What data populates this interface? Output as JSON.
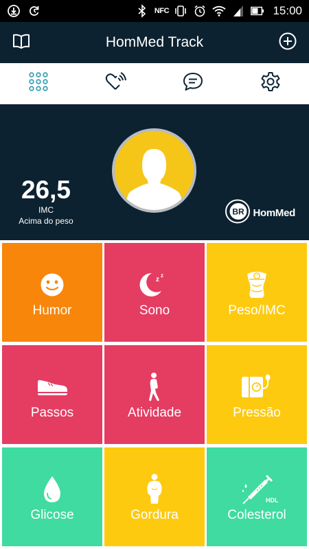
{
  "status_bar": {
    "time": "15:00",
    "nfc_label": "NFC",
    "icons": [
      "download-icon",
      "sync-icon",
      "bluetooth-icon",
      "nfc-icon",
      "vibrate-icon",
      "alarm-icon",
      "wifi-icon",
      "signal-icon",
      "battery-icon"
    ]
  },
  "app_bar": {
    "title": "HomMed Track",
    "left_icon": "book-icon",
    "right_icon": "add-circle-icon"
  },
  "tabs": [
    {
      "icon": "dashboard-grid-icon",
      "selected": true
    },
    {
      "icon": "heart-signal-icon",
      "selected": false
    },
    {
      "icon": "chat-icon",
      "selected": false
    },
    {
      "icon": "settings-icon",
      "selected": false
    }
  ],
  "profile": {
    "bmi_value": "26,5",
    "bmi_label": "IMC",
    "bmi_status": "Acima do peso",
    "avatar_icon": "user-silhouette-icon",
    "logo_mark": "BR",
    "logo_text": "HomMed"
  },
  "tiles": [
    {
      "label": "Humor",
      "icon": "smiley-icon",
      "color": "#f7860b"
    },
    {
      "label": "Sono",
      "icon": "moon-sleep-icon",
      "color": "#e53c62"
    },
    {
      "label": "Peso/IMC",
      "icon": "scale-icon",
      "color": "#fdca10"
    },
    {
      "label": "Passos",
      "icon": "shoe-icon",
      "color": "#e53c62"
    },
    {
      "label": "Atividade",
      "icon": "walking-person-icon",
      "color": "#e53c62"
    },
    {
      "label": "Pressão",
      "icon": "blood-pressure-icon",
      "color": "#fdca10"
    },
    {
      "label": "Glicose",
      "icon": "drop-icon",
      "color": "#3fdba0"
    },
    {
      "label": "Gordura",
      "icon": "body-fat-icon",
      "color": "#fdca10"
    },
    {
      "label": "Colesterol",
      "icon": "syringe-icon",
      "color": "#3fdba0"
    }
  ],
  "cholesterol_badge": "HDL",
  "colors": {
    "dark_navy": "#0c2231",
    "accent_teal": "#3aa3b8",
    "orange": "#f7860b",
    "pink": "#e53c62",
    "yellow": "#fdca10",
    "green": "#3fdba0"
  }
}
